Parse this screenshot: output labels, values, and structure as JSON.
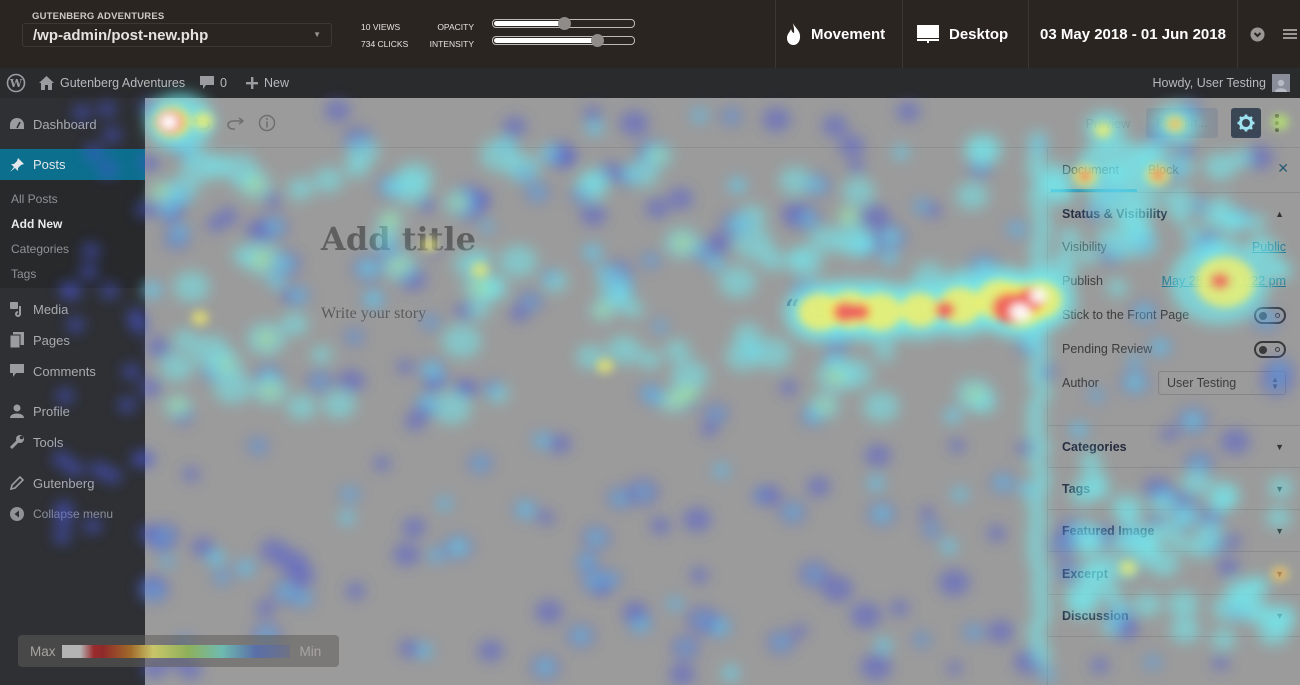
{
  "heatmap_bar": {
    "site_name": "GUTENBERG ADVENTURES",
    "page_url": "/wp-admin/post-new.php",
    "views": "10 VIEWS",
    "clicks": "734 CLICKS",
    "opacity_label": "OPACITY",
    "intensity_label": "INTENSITY",
    "opacity_value": 0.5,
    "intensity_value": 0.74,
    "mode_label": "Movement",
    "mode_icon": "flame-icon",
    "device_label": "Desktop",
    "device_icon": "monitor-icon",
    "date_range": "03 May 2018 - 01 Jun 2018",
    "right_icons": [
      "chevron-down-circle-icon",
      "hamburger-menu-icon"
    ]
  },
  "admin_bar": {
    "site_title": "Gutenberg Adventures",
    "comments_count": "0",
    "new_label": "New",
    "howdy": "Howdy, User Testing"
  },
  "menu": {
    "items": [
      {
        "label": "Dashboard",
        "icon": "dashboard-gauge-icon"
      },
      {
        "label": "Posts",
        "icon": "pin-icon",
        "active": true
      },
      {
        "label": "Media",
        "icon": "media-icon"
      },
      {
        "label": "Pages",
        "icon": "pages-icon"
      },
      {
        "label": "Comments",
        "icon": "comment-icon"
      },
      {
        "label": "Profile",
        "icon": "user-icon"
      },
      {
        "label": "Tools",
        "icon": "wrench-icon"
      },
      {
        "label": "Gutenberg",
        "icon": "pencil-icon"
      },
      {
        "label": "Collapse menu",
        "icon": "collapse-arrow-icon"
      }
    ],
    "posts_submenu": [
      "All Posts",
      "Add New",
      "Categories",
      "Tags"
    ],
    "current_submenu": "Add New"
  },
  "editor": {
    "title_placeholder": "Add title",
    "body_placeholder": "Write your story",
    "preview_label": "Preview",
    "publish_label": "Publish...",
    "sidebar": {
      "tabs": [
        "Document",
        "Block"
      ],
      "active_tab": "Document",
      "status_panel": {
        "title": "Status & Visibility",
        "visibility_label": "Visibility",
        "visibility_value": "Public",
        "publish_label": "Publish",
        "publish_value": "May 28, 2018 1:22 pm",
        "sticky_label": "Stick to the Front Page",
        "sticky_on": false,
        "pending_label": "Pending Review",
        "pending_on": false,
        "author_label": "Author",
        "author_value": "User Testing"
      },
      "panels": [
        "Categories",
        "Tags",
        "Featured Image",
        "Excerpt",
        "Discussion"
      ]
    }
  },
  "legend": {
    "max_label": "Max",
    "min_label": "Min"
  }
}
